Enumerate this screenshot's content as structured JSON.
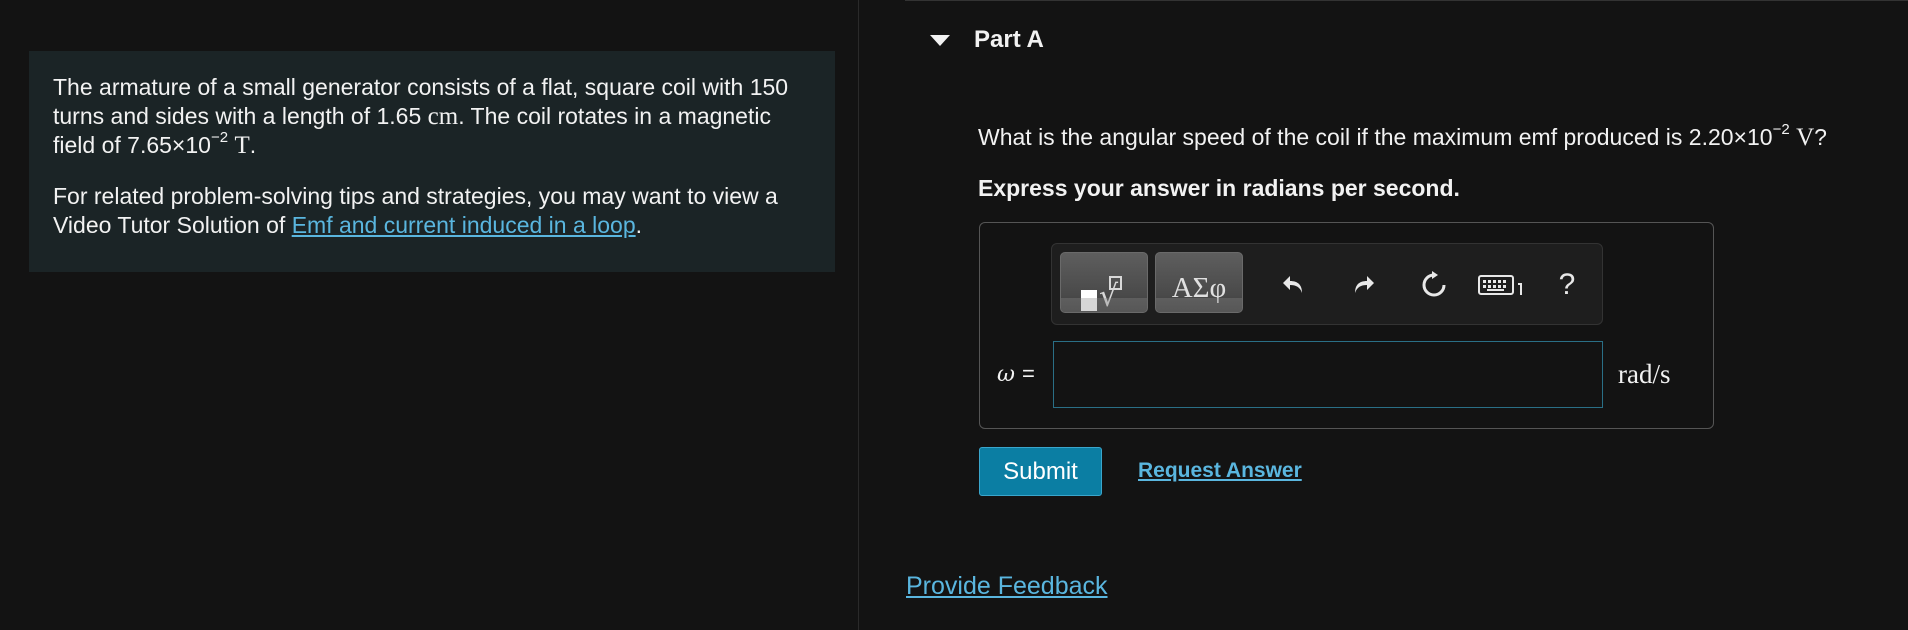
{
  "problem": {
    "line1": "The armature of a small generator consists of a flat, square coil with 150",
    "line2_pre": "turns and sides with a length of 1.65",
    "line2_unit": "cm",
    "line2_post": ". The coil rotates in a magnetic",
    "line3_pre": "field of 7.65×10",
    "line3_exp": "−2",
    "line3_unit": "T",
    "line3_post": ".",
    "tips_line1": "For related problem-solving tips and strategies, you may want to view a",
    "tips_line2_pre": "Video Tutor Solution of",
    "tips_link": "Emf and current induced in a loop",
    "tips_line2_post": "."
  },
  "part": {
    "title": "Part A",
    "question_pre": "What is the angular speed of the coil if the maximum emf produced is 2.20×10",
    "question_exp": "−2",
    "question_unit": "V",
    "question_post": "?",
    "instruction": "Express your answer in radians per second."
  },
  "toolbar": {
    "greek_label": "ΑΣφ",
    "help_label": "?",
    "icons": [
      "templates-icon",
      "greek-letters-icon",
      "undo-icon",
      "redo-icon",
      "reset-icon",
      "keyboard-icon",
      "help-icon"
    ]
  },
  "answer": {
    "variable_label": "ω",
    "equals": "=",
    "value": "",
    "unit": "rad/s"
  },
  "actions": {
    "submit_label": "Submit",
    "request_answer_label": "Request Answer",
    "feedback_label": "Provide Feedback"
  },
  "colors": {
    "link": "#5ab6df",
    "submit_bg": "#0b7ea3",
    "panel_bg": "#1b2426",
    "page_bg": "#131313"
  }
}
